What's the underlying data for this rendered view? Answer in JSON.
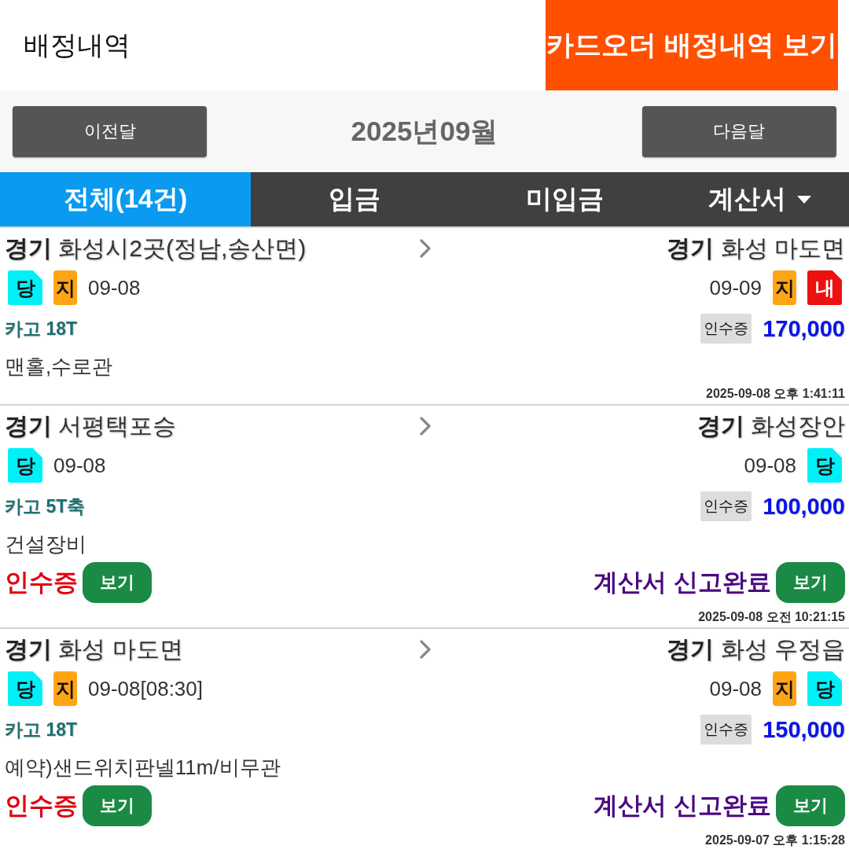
{
  "header": {
    "title": "배정내역",
    "card_order_button": "카드오더 배정내역 보기"
  },
  "month_nav": {
    "prev_button": "이전달",
    "month": "2025년09월",
    "next_button": "다음달"
  },
  "tabs": [
    {
      "label": "전체(14건)",
      "selected": true,
      "dropdown": false
    },
    {
      "label": "입금",
      "selected": false,
      "dropdown": false
    },
    {
      "label": "미입금",
      "selected": false,
      "dropdown": false
    },
    {
      "label": "계산서",
      "selected": false,
      "dropdown": true
    }
  ],
  "orders": [
    {
      "origin": "**경기** 화성시2곳(정남,송산면)",
      "destination": "**경기** 화성 마도면",
      "pickup": {
        "badges": [
          {
            "text": "당",
            "kind": "folded",
            "color": "#00f0f8"
          },
          {
            "text": "지",
            "kind": "plain",
            "color": "#ffa514"
          }
        ],
        "date": "09-08"
      },
      "delivery": {
        "date": "09-09",
        "badges": [
          {
            "text": "지",
            "kind": "plain",
            "color": "#ffa514"
          },
          {
            "text": "내",
            "kind": "folded",
            "color": "#ee1111"
          }
        ]
      },
      "vehicle": "카고 18T",
      "receipt_tag": "인수증",
      "fare": "170,000",
      "memo": "맨홀,수로관",
      "timestamp": "2025-09-08 오후 1:41:11"
    },
    {
      "origin": "**경기** 서평택포승",
      "destination": "**경기** 화성장안",
      "pickup": {
        "badges": [
          {
            "text": "당",
            "kind": "folded",
            "color": "#00f0f8"
          }
        ],
        "date": "09-08"
      },
      "delivery": {
        "date": "09-08",
        "badges": [
          {
            "text": "당",
            "kind": "folded",
            "color": "#00f0f8"
          }
        ]
      },
      "vehicle": "카고 5T축",
      "receipt_tag": "인수증",
      "fare": "100,000",
      "memo": "건설장비",
      "documents": {
        "receipt_label": "인수증",
        "receipt_button": "보기",
        "invoice_status": "계산서 신고완료",
        "invoice_button": "보기"
      },
      "timestamp": "2025-09-08 오전 10:21:15"
    },
    {
      "origin": "**경기** 화성 마도면",
      "destination": "**경기** 화성 우정읍",
      "pickup": {
        "badges": [
          {
            "text": "당",
            "kind": "folded",
            "color": "#00f0f8"
          },
          {
            "text": "지",
            "kind": "plain",
            "color": "#ffa514"
          }
        ],
        "date": "09-08[08:30]"
      },
      "delivery": {
        "date": "09-08",
        "badges": [
          {
            "text": "지",
            "kind": "plain",
            "color": "#ffa514"
          },
          {
            "text": "당",
            "kind": "folded",
            "color": "#00f0f8"
          }
        ]
      },
      "vehicle": "카고 18T",
      "receipt_tag": "인수증",
      "fare": "150,000",
      "memo": "예약)샌드위치판넬11m/비무관",
      "documents": {
        "receipt_label": "인수증",
        "receipt_button": "보기",
        "invoice_status": "계산서 신고완료",
        "invoice_button": "보기"
      },
      "timestamp": "2025-09-07 오후 1:15:28"
    }
  ]
}
